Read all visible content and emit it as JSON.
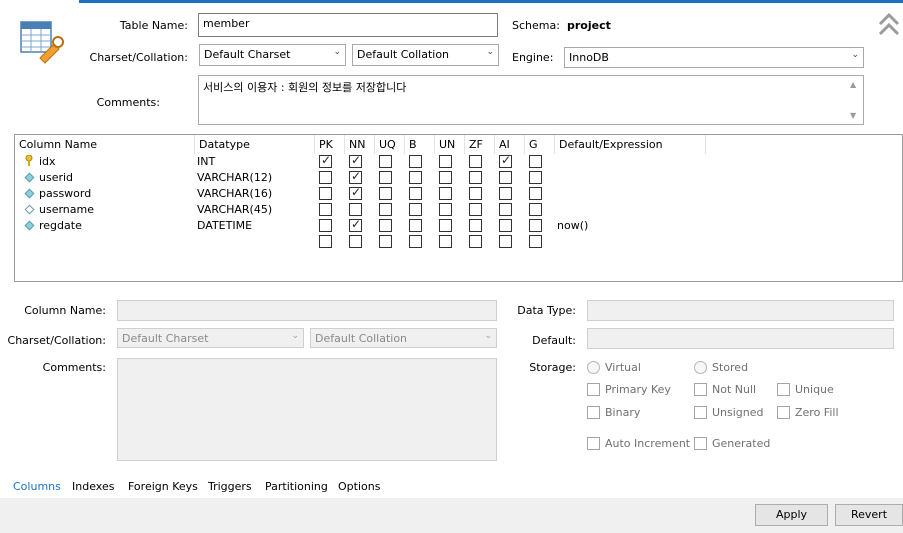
{
  "table": {
    "name_label": "Table Name:",
    "name_value": "member",
    "schema_label": "Schema:",
    "schema_value": "project",
    "charset_label": "Charset/Collation:",
    "charset_value": "Default Charset",
    "collation_value": "Default Collation",
    "engine_label": "Engine:",
    "engine_value": "InnoDB",
    "comments_label": "Comments:",
    "comments_value": "서비스의 이용자 : 회원의 정보를 저장합니다"
  },
  "grid": {
    "headers": {
      "column_name": "Column Name",
      "datatype": "Datatype",
      "pk": "PK",
      "nn": "NN",
      "uq": "UQ",
      "b": "B",
      "un": "UN",
      "zf": "ZF",
      "ai": "AI",
      "g": "G",
      "default": "Default/Expression"
    },
    "rows": [
      {
        "icon": "primary-key-icon",
        "name": "idx",
        "type": "INT",
        "pk": true,
        "nn": true,
        "uq": false,
        "b": false,
        "un": false,
        "zf": false,
        "ai": true,
        "g": false,
        "default": ""
      },
      {
        "icon": "column-notnull-icon",
        "name": "userid",
        "type": "VARCHAR(12)",
        "pk": false,
        "nn": true,
        "uq": false,
        "b": false,
        "un": false,
        "zf": false,
        "ai": false,
        "g": false,
        "default": ""
      },
      {
        "icon": "column-notnull-icon",
        "name": "password",
        "type": "VARCHAR(16)",
        "pk": false,
        "nn": true,
        "uq": false,
        "b": false,
        "un": false,
        "zf": false,
        "ai": false,
        "g": false,
        "default": ""
      },
      {
        "icon": "column-nullable-icon",
        "name": "username",
        "type": "VARCHAR(45)",
        "pk": false,
        "nn": false,
        "uq": false,
        "b": false,
        "un": false,
        "zf": false,
        "ai": false,
        "g": false,
        "default": ""
      },
      {
        "icon": "column-notnull-icon",
        "name": "regdate",
        "type": "DATETIME",
        "pk": false,
        "nn": true,
        "uq": false,
        "b": false,
        "un": false,
        "zf": false,
        "ai": false,
        "g": false,
        "default": "now()"
      }
    ]
  },
  "details": {
    "column_name_label": "Column Name:",
    "charset_label": "Charset/Collation:",
    "charset_value": "Default Charset",
    "collation_value": "Default Collation",
    "comments_label": "Comments:",
    "datatype_label": "Data Type:",
    "default_label": "Default:",
    "storage_label": "Storage:",
    "virtual": "Virtual",
    "stored": "Stored",
    "primary_key": "Primary Key",
    "not_null": "Not Null",
    "unique": "Unique",
    "binary": "Binary",
    "unsigned": "Unsigned",
    "zero_fill": "Zero Fill",
    "auto_increment": "Auto Increment",
    "generated": "Generated"
  },
  "tabs": [
    "Columns",
    "Indexes",
    "Foreign Keys",
    "Triggers",
    "Partitioning",
    "Options"
  ],
  "buttons": {
    "apply": "Apply",
    "revert": "Revert"
  },
  "colors": {
    "accent": "#1f6fc5",
    "active_tab": "#1a73c8"
  }
}
